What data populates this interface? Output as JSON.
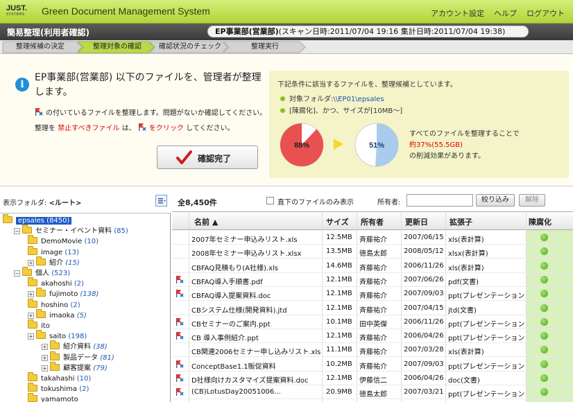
{
  "header": {
    "logo_top": "JUST.",
    "logo_bottom": "SYSTEMS",
    "app_title": "Green Document Management System",
    "links": [
      "アカウント設定",
      "ヘルプ",
      "ログアウト"
    ]
  },
  "titlebar": {
    "page_title": "簡易整理(利用者確認)",
    "dept": "EP事業部(営業部)",
    "scan_info": "(スキャン日時:2011/07/04 19:16  集計日時:2011/07/04 19:38)"
  },
  "steps": [
    {
      "label": "整理候補の決定",
      "active": false
    },
    {
      "label": "整理対象の確認",
      "active": true
    },
    {
      "label": "確認状況のチェック",
      "active": false
    },
    {
      "label": "整理実行",
      "active": false
    }
  ],
  "message": {
    "main": "EP事業部(営業部) 以下のファイルを、管理者が整理します。",
    "line1": "の付いているファイルを整理します。問題がないか確認してください。",
    "line2_a": "整理を",
    "line2_red": "禁止すべきファイル",
    "line2_b": "は、",
    "line2_red2": "をクリック",
    "line2_c": "してください。",
    "confirm_button": "確認完了"
  },
  "conditions": {
    "title": "下記条件に該当するファイルを、整理候補としています。",
    "folder_label": "対象フォルダ:",
    "folder_path": "\\\\EP01\\epsales",
    "criteria": "[陳腐化]、かつ、サイズが[10MB〜]",
    "pie_before": "88%",
    "pie_after": "51%",
    "pie_before_value": 88,
    "pie_after_value": 51,
    "effect_line1": "すべてのファイルを整理することで",
    "effect_red": "約37%(55.5GB)",
    "effect_line2": "の削減効果があります。",
    "colors": {
      "pie_red": "#e95050",
      "pie_blue": "#a9cbec",
      "arrow": "#f1dc2c"
    }
  },
  "tree": {
    "label": "表示フォルダ:",
    "root_label": "<ルート>",
    "nodes": [
      {
        "name": "epsales",
        "count": "(8450)",
        "italic": false
      },
      {
        "name": "セミナー・イベント資料",
        "count": "(85)",
        "italic": false
      },
      {
        "name": "DemoMovie",
        "count": "(10)",
        "italic": false
      },
      {
        "name": "image",
        "count": "(13)",
        "italic": false
      },
      {
        "name": "紹介",
        "count": "(15)",
        "italic": true
      },
      {
        "name": "個人",
        "count": "(523)",
        "italic": false
      },
      {
        "name": "akahoshi",
        "count": "(2)",
        "italic": false
      },
      {
        "name": "fujimoto",
        "count": "(138)",
        "italic": true
      },
      {
        "name": "hoshino",
        "count": "(2)",
        "italic": false
      },
      {
        "name": "imaoka",
        "count": "(5)",
        "italic": true
      },
      {
        "name": "ito",
        "count": "",
        "italic": false
      },
      {
        "name": "saito",
        "count": "(198)",
        "italic": false
      },
      {
        "name": "紹介資料",
        "count": "(38)",
        "italic": true
      },
      {
        "name": "製品データ",
        "count": "(81)",
        "italic": true
      },
      {
        "name": "顧客提案",
        "count": "(79)",
        "italic": true
      },
      {
        "name": "takahashi",
        "count": "(10)",
        "italic": false
      },
      {
        "name": "tokushima",
        "count": "(2)",
        "italic": false
      },
      {
        "name": "yamamoto",
        "count": "",
        "italic": false
      }
    ]
  },
  "list": {
    "total": "全8,450件",
    "only_direct": "直下のファイルのみ表示",
    "owner_label": "所有者:",
    "owner_value": "",
    "filter_button": "絞り込み",
    "clear_button": "解除",
    "columns": [
      "名前 ▲",
      "サイズ",
      "所有者",
      "更新日",
      "拡張子",
      "陳腐化"
    ],
    "rows": [
      {
        "flag": false,
        "name": "2007年セミナー申込みリスト.xls",
        "size": "12.5MB",
        "owner": "斉藤祐介",
        "date": "2007/06/15",
        "ext": "xls(表計算)"
      },
      {
        "flag": false,
        "name": "2008年セミナー申込みリスト.xlsx",
        "size": "13.5MB",
        "owner": "徳島太郎",
        "date": "2008/05/12",
        "ext": "xlsx(表計算)"
      },
      {
        "flag": false,
        "name": "CBFAQ見積もり(A社様).xls",
        "size": "14.6MB",
        "owner": "斉藤祐介",
        "date": "2006/11/26",
        "ext": "xls(表計算)"
      },
      {
        "flag": true,
        "name": "CBFAQ導入手順書.pdf",
        "size": "12.1MB",
        "owner": "斉藤祐介",
        "date": "2007/06/26",
        "ext": "pdf(文書)"
      },
      {
        "flag": true,
        "name": "CBFAQ導入提案資料.doc",
        "size": "12.1MB",
        "owner": "斉藤祐介",
        "date": "2007/09/03",
        "ext": "ppt(プレゼンテーション)"
      },
      {
        "flag": false,
        "name": "CBシステム仕様(開発資料).jtd",
        "size": "12.1MB",
        "owner": "斉藤祐介",
        "date": "2007/04/15",
        "ext": "jtd(文書)"
      },
      {
        "flag": true,
        "name": "CBセミナーのご案内.ppt",
        "size": "10.1MB",
        "owner": "田中英傑",
        "date": "2006/11/26",
        "ext": "ppt(プレゼンテーション)"
      },
      {
        "flag": true,
        "name": "CB 導入事例紹介.ppt",
        "size": "12.1MB",
        "owner": "斉藤祐介",
        "date": "2006/04/26",
        "ext": "ppt(プレゼンテーション)"
      },
      {
        "flag": false,
        "name": "CB関連2006セミナー申し込みリスト.xls",
        "size": "11.1MB",
        "owner": "斉藤祐介",
        "date": "2007/03/28",
        "ext": "xls(表計算)"
      },
      {
        "flag": true,
        "name": "ConceptBase1.1販促資料",
        "size": "10.2MB",
        "owner": "斉藤祐介",
        "date": "2007/09/03",
        "ext": "ppt(プレゼンテーション)"
      },
      {
        "flag": true,
        "name": "D社様向けカスタマイズ提案資料.doc",
        "size": "12.1MB",
        "owner": "伊藤信二",
        "date": "2006/04/26",
        "ext": "doc(文書)"
      },
      {
        "flag": true,
        "name": "(CB)LotusDay20051006...",
        "size": "20.9MB",
        "owner": "徳島太郎",
        "date": "2007/03/21",
        "ext": "ppt(プレゼンテーション)"
      }
    ]
  }
}
